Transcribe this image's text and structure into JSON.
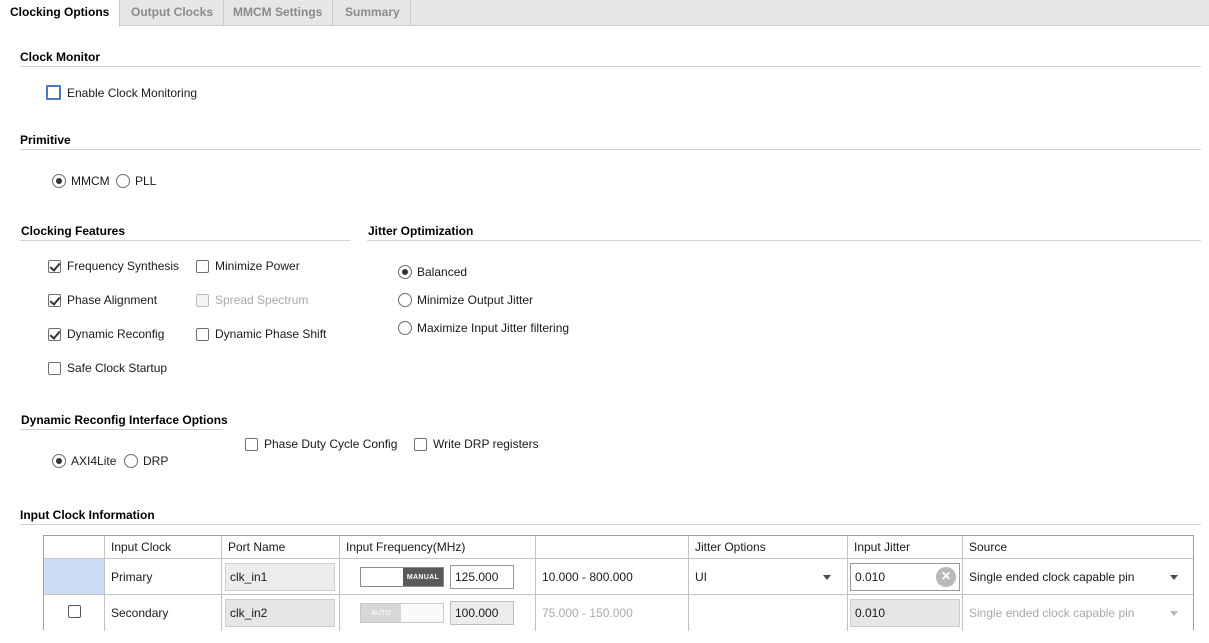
{
  "tabs": [
    {
      "label": "Clocking Options",
      "active": true
    },
    {
      "label": "Output Clocks",
      "active": false
    },
    {
      "label": "MMCM Settings",
      "active": false
    },
    {
      "label": "Summary",
      "active": false
    }
  ],
  "clock_monitor": {
    "title": "Clock Monitor",
    "enable_label": "Enable Clock Monitoring",
    "enabled": false
  },
  "primitive": {
    "title": "Primitive",
    "options": [
      {
        "label": "MMCM",
        "selected": true
      },
      {
        "label": "PLL",
        "selected": false
      }
    ]
  },
  "clocking_features": {
    "title": "Clocking Features",
    "items": [
      {
        "label": "Frequency Synthesis",
        "checked": true,
        "disabled": false
      },
      {
        "label": "Minimize Power",
        "checked": false,
        "disabled": false
      },
      {
        "label": "Phase Alignment",
        "checked": true,
        "disabled": false
      },
      {
        "label": "Spread Spectrum",
        "checked": false,
        "disabled": true
      },
      {
        "label": "Dynamic Reconfig",
        "checked": true,
        "disabled": false
      },
      {
        "label": "Dynamic Phase Shift",
        "checked": false,
        "disabled": false
      },
      {
        "label": "Safe Clock Startup",
        "checked": false,
        "disabled": false
      }
    ]
  },
  "jitter_optimization": {
    "title": "Jitter Optimization",
    "options": [
      {
        "label": "Balanced",
        "selected": true
      },
      {
        "label": "Minimize Output Jitter",
        "selected": false
      },
      {
        "label": "Maximize Input Jitter filtering",
        "selected": false
      }
    ]
  },
  "dynamic_reconfig": {
    "title": "Dynamic Reconfig Interface Options",
    "options": [
      {
        "label": "AXI4Lite",
        "selected": true
      },
      {
        "label": "DRP",
        "selected": false
      }
    ],
    "checks": [
      {
        "label": "Phase Duty Cycle Config",
        "checked": false
      },
      {
        "label": "Write DRP registers",
        "checked": false
      }
    ]
  },
  "input_clock": {
    "title": "Input Clock Information",
    "headers": [
      "",
      "Input Clock",
      "Port Name",
      "Input Frequency(MHz)",
      "",
      "Jitter Options",
      "Input Jitter",
      "Source"
    ],
    "rows": [
      {
        "enabled": true,
        "clock": "Primary",
        "port": "clk_in1",
        "mode_label": "MANUAL",
        "frequency": "125.000",
        "range": "10.000 - 800.000",
        "jitter_option": "UI",
        "jitter": "0.010",
        "source": "Single ended clock capable pin"
      },
      {
        "enabled": false,
        "clock": "Secondary",
        "port": "clk_in2",
        "mode_label": "AUTO",
        "frequency": "100.000",
        "range": "75.000 - 150.000",
        "jitter_option": "",
        "jitter": "0.010",
        "source": "Single ended clock capable pin"
      }
    ]
  },
  "colors": {
    "selected_cell": "#cfdcf7",
    "accent_checkbox": "#4a78c8",
    "tab_bar": "#e6e6e6"
  }
}
